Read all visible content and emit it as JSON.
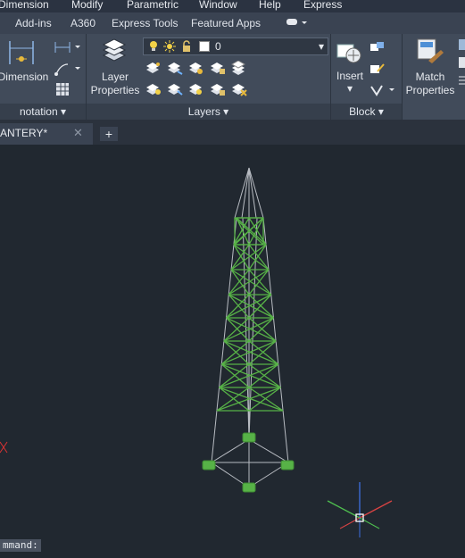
{
  "menu": [
    "Dimension",
    "Modify",
    "Parametric",
    "Window",
    "Help",
    "Express"
  ],
  "ribbon_tabs": [
    "Add-ins",
    "A360",
    "Express Tools",
    "Featured Apps"
  ],
  "ribbon": {
    "dimension_label": "Dimension",
    "layer_properties_label": "Layer Properties",
    "layer_current": "0",
    "insert_label": "Insert",
    "match_properties_label": "Match Properties",
    "panels": {
      "annotation": "notation",
      "layers": "Layers",
      "block": "Block"
    }
  },
  "document_tab": {
    "title": "ANTERY*"
  },
  "command_line": {
    "prompt": "mmand:"
  },
  "colors": {
    "tower": "#57b247",
    "background": "#212830",
    "ribbon": "#414b5a"
  }
}
